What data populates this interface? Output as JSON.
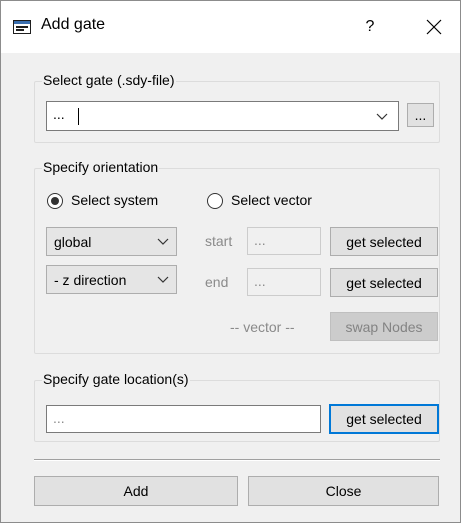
{
  "window": {
    "title": "Add gate",
    "help_glyph": "?",
    "icon": "dialog-window-icon"
  },
  "gate_group": {
    "label": "Select gate (.sdy-file)",
    "combo_value": "...",
    "browse_label": "..."
  },
  "orientation_group": {
    "label": "Specify orientation",
    "radio_system_label": "Select system",
    "radio_vector_label": "Select vector",
    "radio_system_selected": true,
    "system_value": "global",
    "direction_value": "- z direction",
    "start_label": "start",
    "start_value": "...",
    "end_label": "end",
    "end_value": "...",
    "get_selected_start_label": "get selected",
    "get_selected_end_label": "get selected",
    "vector_label": "-- vector --",
    "swap_label": "swap Nodes"
  },
  "location_group": {
    "label": "Specify gate location(s)",
    "placeholder": "...",
    "get_selected_label": "get selected"
  },
  "footer": {
    "add_label": "Add",
    "close_label": "Close"
  },
  "colors": {
    "window_bg": "#f0f0f0",
    "focus_blue": "#0078d7",
    "button_bg": "#e1e1e1"
  }
}
